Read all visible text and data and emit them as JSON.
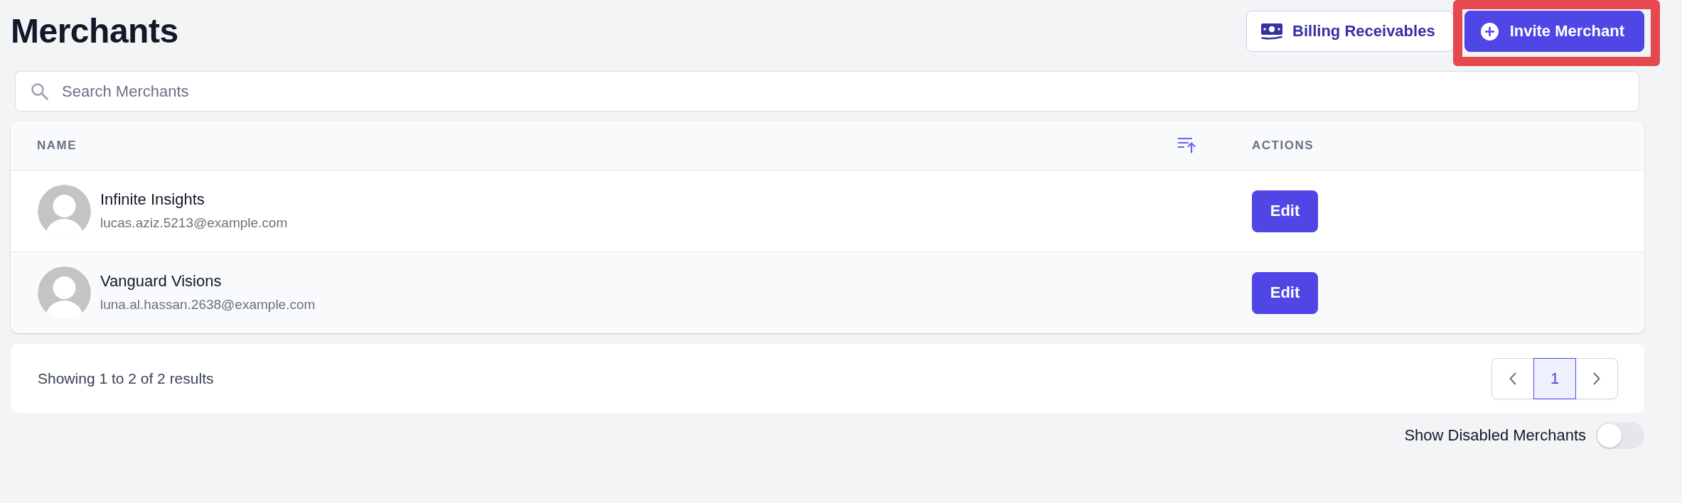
{
  "page": {
    "title": "Merchants"
  },
  "actions": [
    {
      "kind": "secondary",
      "label": "Billing Receivables",
      "highlighted": false
    },
    {
      "kind": "primary",
      "label": "Invite Merchant",
      "highlighted": true
    }
  ],
  "search": {
    "placeholder": "Search Merchants"
  },
  "table": {
    "columns": [
      {
        "label": "NAME",
        "sorted": true
      },
      {
        "label": "ACTIONS",
        "sorted": false
      }
    ],
    "rows": [
      {
        "name": "Infinite Insights",
        "email": "lucas.aziz.5213@example.com",
        "action": "Edit"
      },
      {
        "name": "Vanguard Visions",
        "email": "luna.al.hassan.2638@example.com",
        "action": "Edit"
      }
    ]
  },
  "pagination": {
    "summary": "Showing 1 to 2 of 2 results",
    "pages": [
      {
        "label": "1",
        "selected": true
      }
    ]
  },
  "toggle": {
    "label": "Show Disabled Merchants",
    "on": false
  }
}
